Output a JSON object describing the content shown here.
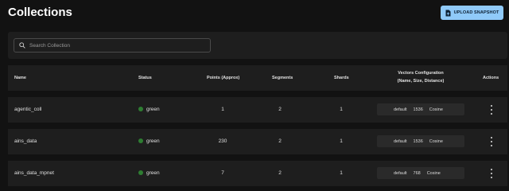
{
  "header": {
    "title": "Collections",
    "upload_label": "UPLOAD SNAPSHOT",
    "upload_icon": "document-icon"
  },
  "search": {
    "placeholder": "Search Collection",
    "icon": "search-icon"
  },
  "table": {
    "columns": {
      "name": "Name",
      "status": "Status",
      "points": "Points (Approx)",
      "segments": "Segments",
      "shards": "Shards",
      "vectors_line1": "Vectors Configuration",
      "vectors_line2": "(Name, Size, Distance)",
      "actions": "Actions"
    },
    "rows": [
      {
        "name": "agentic_coll",
        "status": "green",
        "points": "1",
        "segments": "2",
        "shards": "1",
        "vector_name": "default",
        "vector_size": "1536",
        "vector_distance": "Cosine"
      },
      {
        "name": "ains_data",
        "status": "green",
        "points": "230",
        "segments": "2",
        "shards": "1",
        "vector_name": "default",
        "vector_size": "1536",
        "vector_distance": "Cosine"
      },
      {
        "name": "ains_data_mpnet",
        "status": "green",
        "points": "7",
        "segments": "2",
        "shards": "1",
        "vector_name": "default",
        "vector_size": "768",
        "vector_distance": "Cosine"
      }
    ]
  },
  "colors": {
    "background": "#121212",
    "panel": "#1e1e1e",
    "accent": "#90caf9",
    "status_green": "#2e7d32"
  }
}
